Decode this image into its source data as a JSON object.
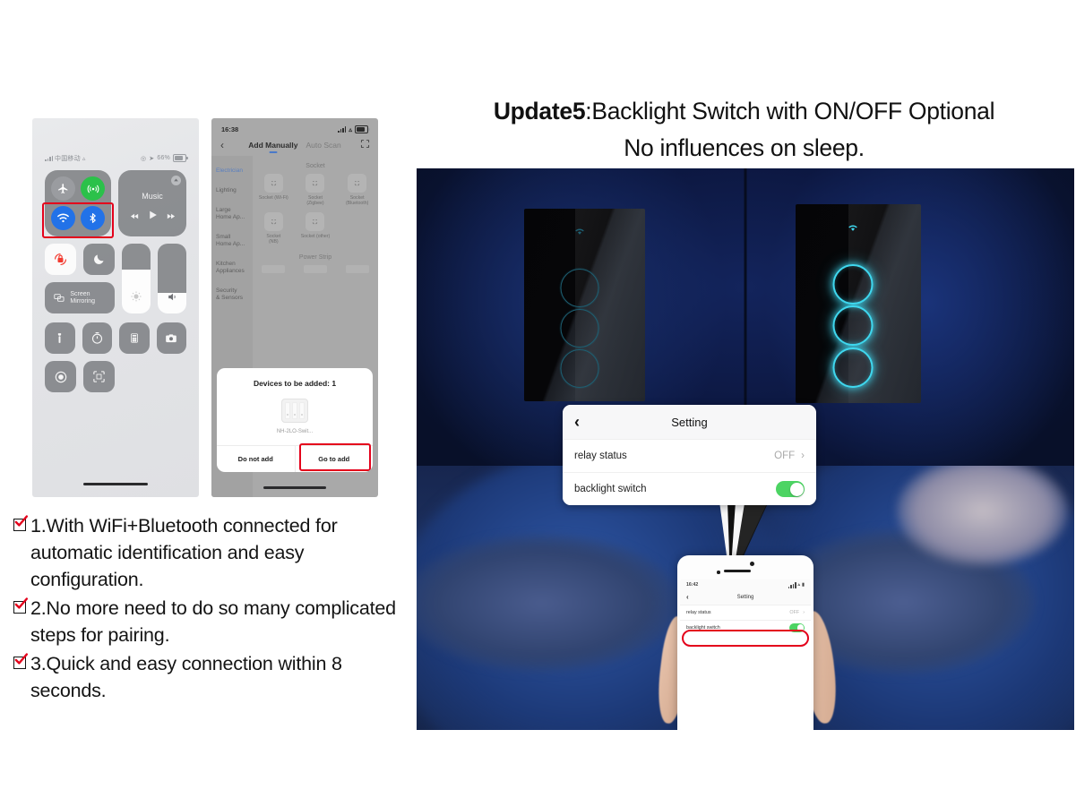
{
  "headline": {
    "bold_prefix": "Update5",
    "line1_rest": ":Backlight Switch with ON/OFF Optional",
    "line2": "No influences on sleep."
  },
  "phone1": {
    "name": "ios-control-center",
    "status": {
      "carrier": "中国移动",
      "battery_percent": "66%"
    },
    "tiles": {
      "airplane": "airplane-mode",
      "cellular": "cellular-data",
      "wifi": "wifi",
      "bluetooth": "bluetooth",
      "music_title": "Music",
      "rotation_lock": "rotation-lock",
      "do_not_disturb": "do-not-disturb",
      "screen_mirroring": "Screen Mirroring",
      "brightness": "brightness-slider",
      "volume": "volume-slider",
      "flashlight": "flashlight",
      "timer": "timer",
      "calculator": "calculator",
      "camera": "camera",
      "screen_record": "screen-record",
      "qr_scan": "qr-code-scanner"
    },
    "highlight": "wifi-and-bluetooth-highlighted"
  },
  "phone2": {
    "name": "smart-life-add-device",
    "status": {
      "time": "16:38"
    },
    "nav": {
      "back": "‹",
      "tab_active": "Add Manually",
      "tab_inactive": "Auto Scan",
      "scan_icon": "scan-icon"
    },
    "categories": [
      {
        "label": "Electrician",
        "active": true
      },
      {
        "label": "Lighting",
        "active": false
      },
      {
        "label": "Large\nHome Ap...",
        "active": false
      },
      {
        "label": "Small\nHome Ap...",
        "active": false
      },
      {
        "label": "Kitchen\nAppliances",
        "active": false
      },
      {
        "label": "Security\n& Sensors",
        "active": false
      }
    ],
    "sections": [
      {
        "title": "Socket",
        "devices": [
          "Socket (Wi-Fi)",
          "Socket\n(Zigbee)",
          "Socket\n(Bluetooth)",
          "Socket\n(NB)",
          "Socket (other)"
        ]
      },
      {
        "title": "Power Strip",
        "devices": []
      }
    ],
    "dialog": {
      "title": "Devices to be added: 1",
      "device_name": "NH-2LO-Swit...",
      "button_cancel": "Do not add",
      "button_confirm": "Go to add",
      "highlight": "go-to-add-highlighted"
    }
  },
  "bullets": [
    "1.With WiFi+Bluetooth connected for automatic identification and easy configuration.",
    "2.No more need to do so many complicated steps for pairing.",
    "3.Quick and easy connection within 8 seconds."
  ],
  "photo": {
    "panel_left": {
      "state": "backlight-off",
      "buttons": 3,
      "icon": "wifi-icon"
    },
    "panel_right": {
      "state": "backlight-on",
      "buttons": 3,
      "icon": "wifi-icon"
    },
    "callout": {
      "back": "‹",
      "title": "Setting",
      "rows": [
        {
          "label": "relay status",
          "value": "OFF",
          "chevron": "›",
          "type": "value"
        },
        {
          "label": "backlight switch",
          "value": "ON",
          "type": "toggle"
        }
      ]
    },
    "held_phone": {
      "status_time": "16:42",
      "back": "‹",
      "title": "Setting",
      "rows": [
        {
          "label": "relay status",
          "value": "OFF",
          "chevron": "›",
          "type": "value"
        },
        {
          "label": "backlight switch",
          "value": "ON",
          "type": "toggle"
        }
      ],
      "highlight": "backlight-switch-row-highlighted"
    }
  },
  "colors": {
    "red_highlight": "#e4011b",
    "toggle_green": "#4cd463",
    "glow_cyan": "#3fd8ef",
    "accent_blue": "#2272e8"
  }
}
